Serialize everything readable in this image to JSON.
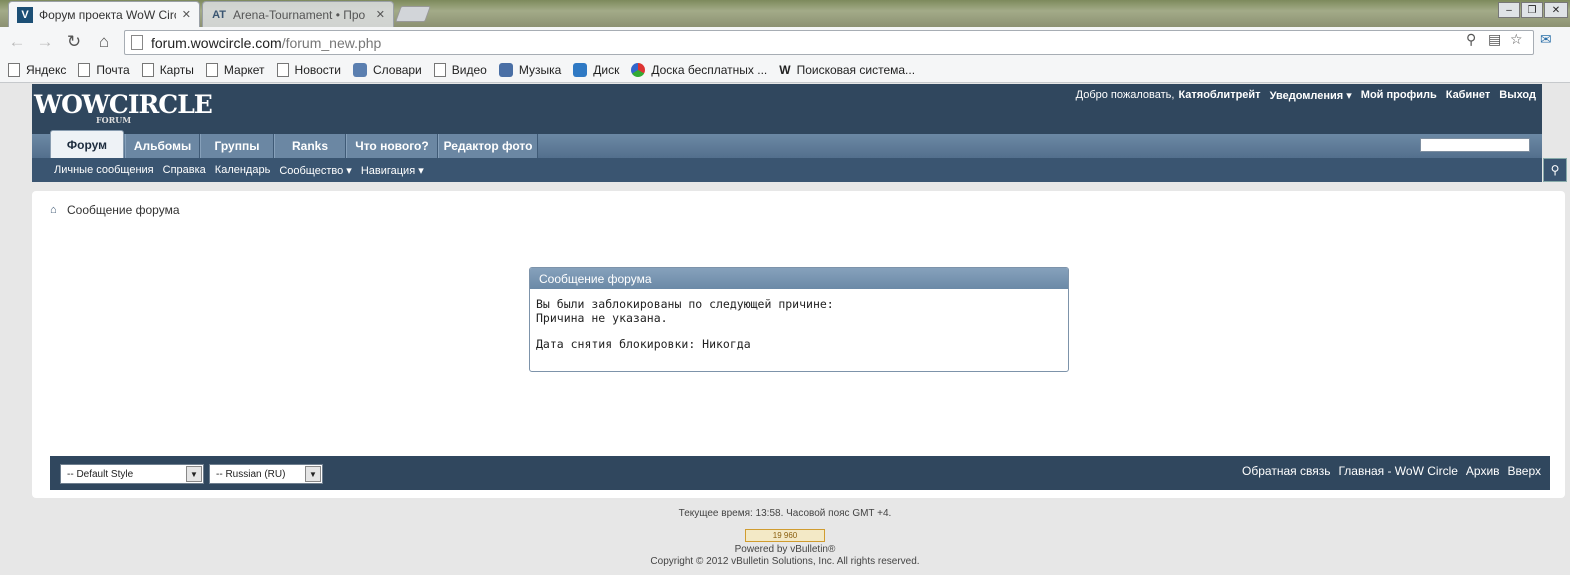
{
  "browser": {
    "tabs": [
      {
        "title": "Форум проекта WoW Circ",
        "favicon": "V",
        "active": true
      },
      {
        "title": "Arena-Tournament • Про",
        "favicon": "AT",
        "active": false
      }
    ],
    "url_host": "forum.wowcircle.com",
    "url_path": "/forum_new.php",
    "bookmarks": [
      "Яндекс",
      "Почта",
      "Карты",
      "Маркет",
      "Новости",
      "Словари",
      "Видео",
      "Музыка",
      "Диск",
      "Доска бесплатных ...",
      "Поисковая система..."
    ]
  },
  "forum": {
    "logo": "WOWCIRCLE",
    "logo_sub": "FORUM",
    "welcome": "Добро пожаловать,",
    "username": "Катяоблитрейт",
    "notifications": "Уведомления ▾",
    "my_profile": "Мой профиль",
    "cabinet": "Кабинет",
    "logout": "Выход",
    "tabs": [
      "Форум",
      "Альбомы",
      "Группы",
      "Ranks",
      "Что нового?",
      "Редактор фото"
    ],
    "subnav": [
      "Личные сообщения",
      "Справка",
      "Календарь",
      "Сообщество ▾",
      "Навигация ▾"
    ],
    "breadcrumb": "Сообщение форума",
    "message": {
      "title": "Сообщение форума",
      "line1": "Вы были заблокированы по следующей причине:",
      "line2": "Причина не указана.",
      "line3": "Дата снятия блокировки: Никогда"
    },
    "footer": {
      "style_select": "-- Default Style",
      "lang_select": "-- Russian (RU)",
      "links": [
        "Обратная связь",
        "Главная - WoW Circle",
        "Архив",
        "Вверх"
      ]
    },
    "bottom": {
      "time": "Текущее время: 13:58. Часовой пояс GMT +4.",
      "counter": "19 960",
      "powered": "Powered by vBulletin®",
      "copyright": "Copyright © 2012 vBulletin Solutions, Inc. All rights reserved."
    }
  }
}
